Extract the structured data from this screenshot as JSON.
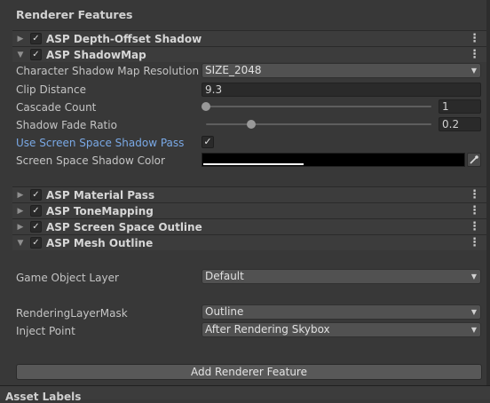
{
  "section_title": "Renderer Features",
  "features": [
    {
      "name": "ASP Depth-Offset Shadow",
      "enabled": true,
      "expanded": false
    },
    {
      "name": "ASP ShadowMap",
      "enabled": true,
      "expanded": true
    },
    {
      "name": "ASP Material Pass",
      "enabled": true,
      "expanded": false
    },
    {
      "name": "ASP ToneMapping",
      "enabled": true,
      "expanded": false
    },
    {
      "name": "ASP Screen Space Outline",
      "enabled": true,
      "expanded": false
    },
    {
      "name": "ASP Mesh Outline",
      "enabled": true,
      "expanded": true
    }
  ],
  "shadowmap": {
    "resolution_label": "Character Shadow Map Resolution",
    "resolution_value": "SIZE_2048",
    "clip_distance_label": "Clip Distance",
    "clip_distance_value": "9.3",
    "cascade_count_label": "Cascade Count",
    "cascade_count_value": "1",
    "cascade_count_fraction": 0.0,
    "shadow_fade_label": "Shadow Fade Ratio",
    "shadow_fade_value": "0.2",
    "shadow_fade_fraction": 0.2,
    "screen_space_label": "Use Screen Space Shadow Pass",
    "screen_space_checked": true,
    "shadow_color_label": "Screen Space Shadow Color",
    "shadow_color": "#000000"
  },
  "mesh_outline": {
    "layer_label": "Game Object Layer",
    "layer_value": "Default",
    "mask_label": "RenderingLayerMask",
    "mask_value": "Outline",
    "inject_label": "Inject Point",
    "inject_value": "After Rendering Skybox"
  },
  "add_button": "Add Renderer Feature",
  "bottom_section": "Asset Labels",
  "glyphs": {
    "collapsed": "▶",
    "expanded": "▼",
    "check": "✓",
    "caret": "▼",
    "kebab": "⋮"
  },
  "colors": {
    "accent_link": "#7aa9e6",
    "background": "#383838"
  }
}
